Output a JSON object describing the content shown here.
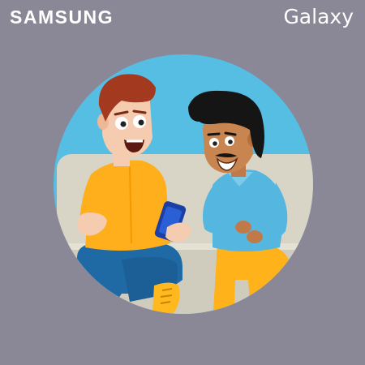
{
  "brand": {
    "left_logo": "SAMSUNG",
    "right_logo": "Galaxy"
  },
  "colors": {
    "background": "#8a8796",
    "circle_sky": "#56bde3",
    "sofa": "#d8d4c6",
    "left_shirt": "#ffae1c",
    "right_shirt": "#55b7df",
    "jeans": "#1f6aa4",
    "right_pants": "#ffb21a",
    "phone": "#1b3fa4"
  }
}
